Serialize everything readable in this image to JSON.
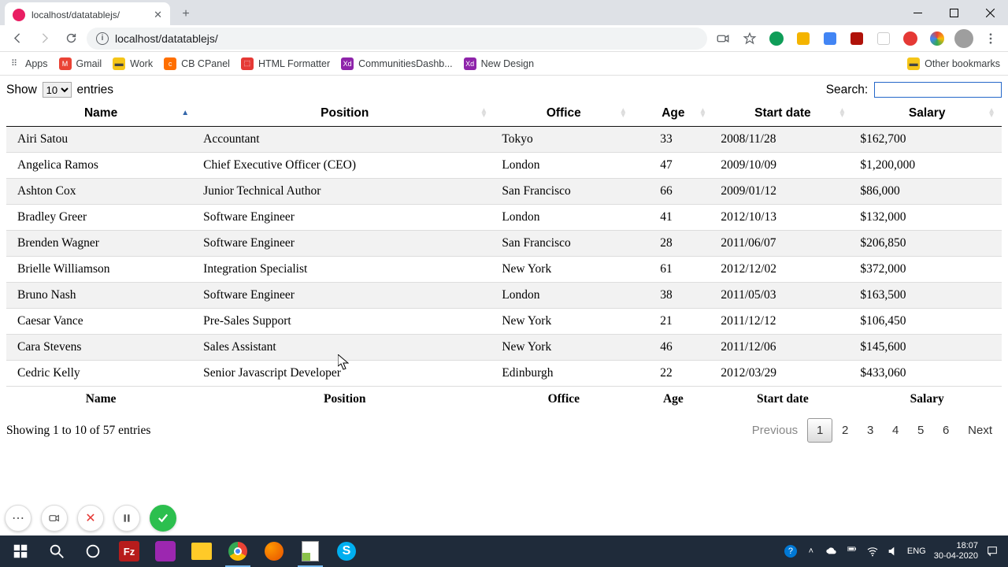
{
  "browser": {
    "tab_title": "localhost/datatablejs/",
    "url": "localhost/datatablejs/"
  },
  "bookmarks": [
    {
      "label": "Apps",
      "color": "#5f6368",
      "type": "apps"
    },
    {
      "label": "Gmail",
      "color": "#ea4335",
      "letter": "M"
    },
    {
      "label": "Work",
      "color": "#5f6368",
      "type": "folder"
    },
    {
      "label": "CB CPanel",
      "color": "#ff6f00",
      "letter": "c"
    },
    {
      "label": "HTML Formatter",
      "color": "#e53935",
      "letter": "⬚"
    },
    {
      "label": "CommunitiesDashb...",
      "color": "#8e24aa",
      "letter": "Xd"
    },
    {
      "label": "New Design",
      "color": "#8e24aa",
      "letter": "Xd"
    }
  ],
  "other_bookmarks_label": "Other bookmarks",
  "datatable": {
    "length_prefix": "Show",
    "length_value": "10",
    "length_suffix": "entries",
    "search_label": "Search:",
    "search_value": "",
    "columns": [
      "Name",
      "Position",
      "Office",
      "Age",
      "Start date",
      "Salary"
    ],
    "sorted_column": 0,
    "sorted_dir": "asc",
    "rows": [
      {
        "name": "Airi Satou",
        "position": "Accountant",
        "office": "Tokyo",
        "age": "33",
        "date": "2008/11/28",
        "salary": "$162,700"
      },
      {
        "name": "Angelica Ramos",
        "position": "Chief Executive Officer (CEO)",
        "office": "London",
        "age": "47",
        "date": "2009/10/09",
        "salary": "$1,200,000"
      },
      {
        "name": "Ashton Cox",
        "position": "Junior Technical Author",
        "office": "San Francisco",
        "age": "66",
        "date": "2009/01/12",
        "salary": "$86,000"
      },
      {
        "name": "Bradley Greer",
        "position": "Software Engineer",
        "office": "London",
        "age": "41",
        "date": "2012/10/13",
        "salary": "$132,000"
      },
      {
        "name": "Brenden Wagner",
        "position": "Software Engineer",
        "office": "San Francisco",
        "age": "28",
        "date": "2011/06/07",
        "salary": "$206,850"
      },
      {
        "name": "Brielle Williamson",
        "position": "Integration Specialist",
        "office": "New York",
        "age": "61",
        "date": "2012/12/02",
        "salary": "$372,000"
      },
      {
        "name": "Bruno Nash",
        "position": "Software Engineer",
        "office": "London",
        "age": "38",
        "date": "2011/05/03",
        "salary": "$163,500"
      },
      {
        "name": "Caesar Vance",
        "position": "Pre-Sales Support",
        "office": "New York",
        "age": "21",
        "date": "2011/12/12",
        "salary": "$106,450"
      },
      {
        "name": "Cara Stevens",
        "position": "Sales Assistant",
        "office": "New York",
        "age": "46",
        "date": "2011/12/06",
        "salary": "$145,600"
      },
      {
        "name": "Cedric Kelly",
        "position": "Senior Javascript Developer",
        "office": "Edinburgh",
        "age": "22",
        "date": "2012/03/29",
        "salary": "$433,060"
      }
    ],
    "info": "Showing 1 to 10 of 57 entries",
    "paging": {
      "previous": "Previous",
      "next": "Next",
      "pages": [
        "1",
        "2",
        "3",
        "4",
        "5",
        "6"
      ],
      "current": "1"
    }
  },
  "tray": {
    "lang": "ENG",
    "time": "18:07",
    "date": "30-04-2020"
  }
}
